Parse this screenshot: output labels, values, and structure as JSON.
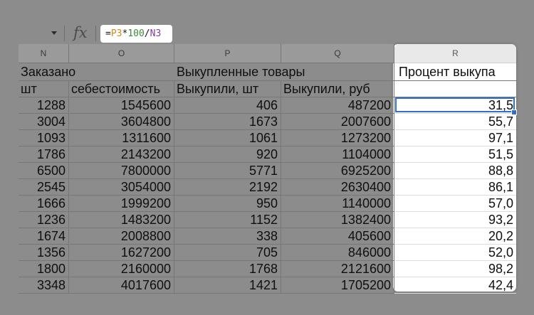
{
  "formula_bar": {
    "name_box_value": "",
    "fx_label": "fx",
    "formula_parts": [
      "=",
      "P3",
      "*",
      "100",
      "/",
      "N3"
    ]
  },
  "columns": [
    "N",
    "O",
    "P",
    "Q",
    "R"
  ],
  "header_row_1": {
    "N": "Заказано",
    "O": "",
    "P": "Выкупленные товары",
    "Q": "",
    "R": "Процент выкупа"
  },
  "header_row_2": {
    "N": "шт",
    "O": "себестоимость",
    "P": "Выкупили, шт",
    "Q": "Выкупили, руб",
    "R": ""
  },
  "rows": [
    [
      "1288",
      "1545600",
      "406",
      "487200",
      "31,5"
    ],
    [
      "3004",
      "3604800",
      "1673",
      "2007600",
      "55,7"
    ],
    [
      "1093",
      "1311600",
      "1061",
      "1273200",
      "97,1"
    ],
    [
      "1786",
      "2143200",
      "920",
      "1104000",
      "51,5"
    ],
    [
      "6500",
      "7800000",
      "5771",
      "6925200",
      "88,8"
    ],
    [
      "2545",
      "3054000",
      "2192",
      "2630400",
      "86,1"
    ],
    [
      "1666",
      "1999200",
      "950",
      "1140000",
      "57,0"
    ],
    [
      "1236",
      "1483200",
      "1152",
      "1382400",
      "93,2"
    ],
    [
      "1674",
      "2008800",
      "338",
      "405600",
      "20,2"
    ],
    [
      "1356",
      "1627200",
      "705",
      "846000",
      "52,0"
    ],
    [
      "1800",
      "2160000",
      "1768",
      "2121600",
      "98,2"
    ],
    [
      "3348",
      "4017600",
      "1421",
      "1705200",
      "42,4"
    ]
  ],
  "colors": {
    "selection": "#2f6fd8",
    "ref_P3": "#d68a10",
    "ref_N3": "#8b3aa0"
  }
}
